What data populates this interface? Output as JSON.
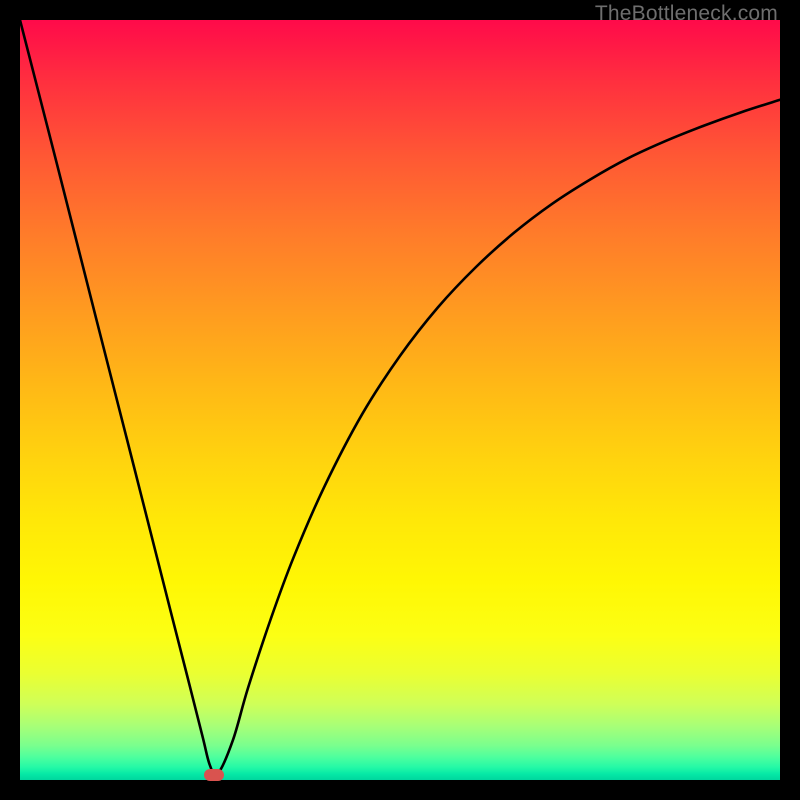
{
  "watermark": "TheBottleneck.com",
  "chart_data": {
    "type": "line",
    "title": "",
    "xlabel": "",
    "ylabel": "",
    "xlim": [
      0,
      100
    ],
    "ylim": [
      0,
      100
    ],
    "grid": false,
    "background_gradient": {
      "top": "#ff0a4a",
      "bottom": "#00d69e"
    },
    "series": [
      {
        "name": "curve",
        "x": [
          0,
          5,
          10,
          15,
          20,
          22,
          24,
          25,
          26,
          28,
          30,
          33,
          36,
          40,
          45,
          50,
          55,
          60,
          65,
          70,
          75,
          80,
          85,
          90,
          95,
          100
        ],
        "y": [
          100,
          80.5,
          60.8,
          41.2,
          21.5,
          13.7,
          5.8,
          1.9,
          0.8,
          5.2,
          12.1,
          21.2,
          29.3,
          38.5,
          48.1,
          55.8,
          62.2,
          67.5,
          72.0,
          75.8,
          79.0,
          81.8,
          84.1,
          86.1,
          87.9,
          89.5
        ]
      }
    ],
    "annotations": [
      {
        "type": "marker",
        "shape": "pill",
        "x": 25.5,
        "y": 0.6,
        "color": "#d9534f"
      }
    ]
  }
}
